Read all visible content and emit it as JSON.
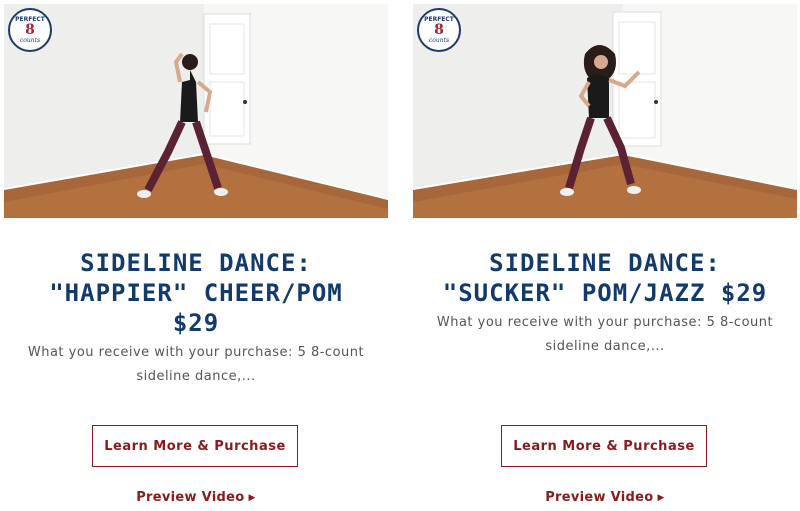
{
  "logo": {
    "line1": "PERFECT",
    "line2": "8",
    "line3": "counts"
  },
  "cards": [
    {
      "title_lines": [
        "SIDELINE DANCE:",
        "\"HAPPIER\" CHEER/POM",
        "$29"
      ],
      "description_lines": [
        "What you receive with your purchase: 5 8-count",
        "sideline dance,..."
      ],
      "button_label": "Learn More & Purchase",
      "preview_label": "Preview Video",
      "preview_icon": "play-arrow-icon"
    },
    {
      "title_lines": [
        "SIDELINE DANCE:",
        "\"SUCKER\" POM/JAZZ $29"
      ],
      "description_lines": [
        "What you receive with your purchase: 5 8-count",
        "sideline dance,..."
      ],
      "button_label": "Learn More & Purchase",
      "preview_label": "Preview Video",
      "preview_icon": "play-arrow-icon"
    }
  ],
  "colors": {
    "title": "#123a6a",
    "accent": "#8b1a1a",
    "text": "#555555"
  }
}
